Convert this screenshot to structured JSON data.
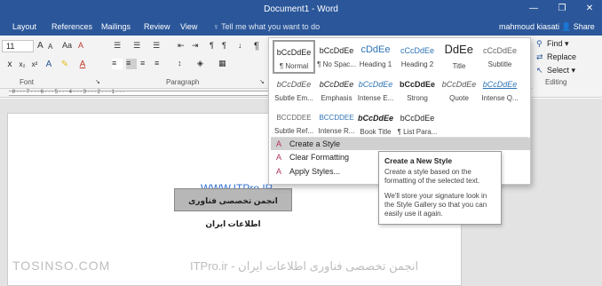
{
  "window": {
    "title": "Document1 - Word",
    "controls": [
      "—",
      "❐",
      "✕"
    ]
  },
  "tabs": [
    "Layout",
    "References",
    "Mailings",
    "Review",
    "View"
  ],
  "tell_me": "Tell me what you want to do",
  "user_name": "mahmoud kiasati",
  "share_label": "Share",
  "ribbon": {
    "font_size": "11",
    "groups": {
      "font": "Font",
      "paragraph": "Paragraph",
      "editing": "Editing"
    },
    "editing_items": [
      "Find ▾",
      "Replace",
      "Select ▾"
    ]
  },
  "ruler_text": "· 8 · · · 7 · · · 6 · · · 5 · · · 4 · · · 3 · · · 2 · · · 1 · · ·",
  "styles_gallery": {
    "rows": [
      [
        {
          "sample": "bCcDdEe",
          "name": "¶ Normal"
        },
        {
          "sample": "bCcDdEe",
          "name": "¶ No Spac..."
        },
        {
          "sample": "cDdEe",
          "name": "Heading 1"
        },
        {
          "sample": "cCcDdEe",
          "name": "Heading 2"
        },
        {
          "sample": "ᎠdEe",
          "name": "Title"
        },
        {
          "sample": "cCcDdEe",
          "name": "Subtitle"
        }
      ],
      [
        {
          "sample": "bCcDdEe",
          "name": "Subtle Em..."
        },
        {
          "sample": "bCcDdEe",
          "name": "Emphasis"
        },
        {
          "sample": "bCcDdEe",
          "name": "Intense E..."
        },
        {
          "sample": "bCcDdEe",
          "name": "Strong"
        },
        {
          "sample": "bCcDdEe",
          "name": "Quote"
        },
        {
          "sample": "bCcDdEe",
          "name": "Intense Q..."
        }
      ],
      [
        {
          "sample": "BCCDDEE",
          "name": "Subtle Ref..."
        },
        {
          "sample": "BCCDDEE",
          "name": "Intense R..."
        },
        {
          "sample": "bCcDdEe",
          "name": "Book Title"
        },
        {
          "sample": "bCcDdEe",
          "name": "¶ List Para..."
        }
      ]
    ],
    "menu": [
      "Create a Style",
      "Clear Formatting",
      "Apply Styles..."
    ]
  },
  "tooltip": {
    "title": "Create a New Style",
    "p1": "Create a style based on the formatting of the selected text.",
    "p2": "We'll store your signature look in the Style Gallery so that you can easily use it again."
  },
  "document": {
    "link_text": "WWW.ITPro.IR",
    "highlighted_text": "انجمن تخصصی فناوری اطلاعات ایران"
  },
  "watermarks": {
    "left": "TOSINSO.COM",
    "center": "ITPro.ir - انجمن تخصصی فناوری اطلاعات ایران"
  },
  "colors": {
    "brand": "#2b579a",
    "link": "#2f6fd1",
    "menu_highlight": "#d0d0d0"
  }
}
